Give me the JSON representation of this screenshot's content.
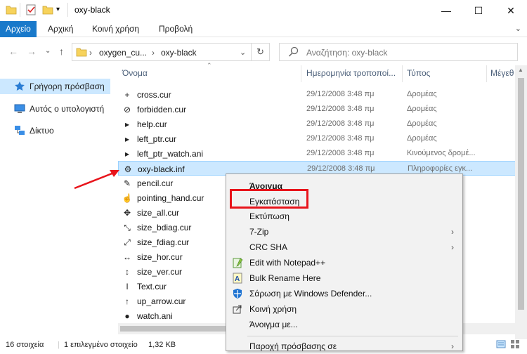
{
  "window": {
    "title": "oxy-black",
    "minimize_glyph": "—",
    "maximize_glyph": "☐",
    "close_glyph": "✕"
  },
  "ribbon": {
    "tabs": [
      "Αρχείο",
      "Αρχική",
      "Κοινή χρήση",
      "Προβολή"
    ],
    "expand_glyph": "⌄"
  },
  "address": {
    "crumbs": [
      "oxygen_cu...",
      "oxy-black"
    ],
    "search_placeholder": "Αναζήτηση: oxy-black",
    "back_glyph": "←",
    "forward_glyph": "→",
    "recent_glyph": "⌄",
    "up_glyph": "↑",
    "refresh_glyph": "↻",
    "dropdown_glyph": "⌄"
  },
  "nav": {
    "items": [
      "Γρήγορη πρόσβαση",
      "Αυτός ο υπολογιστή",
      "Δίκτυο"
    ]
  },
  "columns": {
    "name": "Όνομα",
    "date": "Ημερομηνία τροποποί...",
    "type": "Τύπος",
    "size": "Μέγεθ"
  },
  "files": [
    {
      "name": "cross.cur",
      "date": "29/12/2008 3:48 πμ",
      "type": "Δρομέας",
      "icon": "+"
    },
    {
      "name": "forbidden.cur",
      "date": "29/12/2008 3:48 πμ",
      "type": "Δρομέας",
      "icon": "⊘"
    },
    {
      "name": "help.cur",
      "date": "29/12/2008 3:48 πμ",
      "type": "Δρομέας",
      "icon": "▸"
    },
    {
      "name": "left_ptr.cur",
      "date": "29/12/2008 3:48 πμ",
      "type": "Δρομέας",
      "icon": "▸"
    },
    {
      "name": "left_ptr_watch.ani",
      "date": "29/12/2008 3:48 πμ",
      "type": "Κινούμενος δρομέ...",
      "icon": "▸"
    },
    {
      "name": "oxy-black.inf",
      "date": "29/12/2008 3:48 πμ",
      "type": "Πληροφορίες εγκ...",
      "icon": "⚙"
    },
    {
      "name": "pencil.cur",
      "date": "",
      "type": "",
      "icon": "✎"
    },
    {
      "name": "pointing_hand.cur",
      "date": "",
      "type": "",
      "icon": "☝"
    },
    {
      "name": "size_all.cur",
      "date": "",
      "type": "",
      "icon": "✥"
    },
    {
      "name": "size_bdiag.cur",
      "date": "",
      "type": "",
      "icon": "⤡"
    },
    {
      "name": "size_fdiag.cur",
      "date": "",
      "type": "",
      "icon": "⤢"
    },
    {
      "name": "size_hor.cur",
      "date": "",
      "type": "",
      "icon": "↔"
    },
    {
      "name": "size_ver.cur",
      "date": "",
      "type": "",
      "icon": "↕"
    },
    {
      "name": "Text.cur",
      "date": "",
      "type": "",
      "icon": "I"
    },
    {
      "name": "up_arrow.cur",
      "date": "",
      "type": "",
      "icon": "↑"
    },
    {
      "name": "watch.ani",
      "date": "",
      "type": "",
      "icon": "●"
    }
  ],
  "context_menu": {
    "items": [
      {
        "label": "Άνοιγμα",
        "bold": true
      },
      {
        "label": "Εγκατάσταση"
      },
      {
        "label": "Εκτύπωση"
      },
      {
        "label": "7-Zip",
        "submenu": true
      },
      {
        "label": "CRC SHA",
        "submenu": true
      },
      {
        "label": "Edit with Notepad++"
      },
      {
        "label": "Bulk Rename Here"
      },
      {
        "label": "Σάρωση με Windows Defender..."
      },
      {
        "label": "Κοινή χρήση"
      },
      {
        "label": "Άνοιγμα με..."
      },
      {
        "label": "Παροχή πρόσβασης σε",
        "submenu": true
      }
    ],
    "submenu_glyph": "›"
  },
  "status": {
    "count": "16 στοιχεία",
    "selected": "1 επιλεγμένο στοιχείο",
    "size": "1,32 KB"
  },
  "colors": {
    "ribbon_file_tab": "#1979ca",
    "selection": "#cce8ff",
    "highlight_box": "#e8141b",
    "annotation_arrow": "#e8141b"
  }
}
